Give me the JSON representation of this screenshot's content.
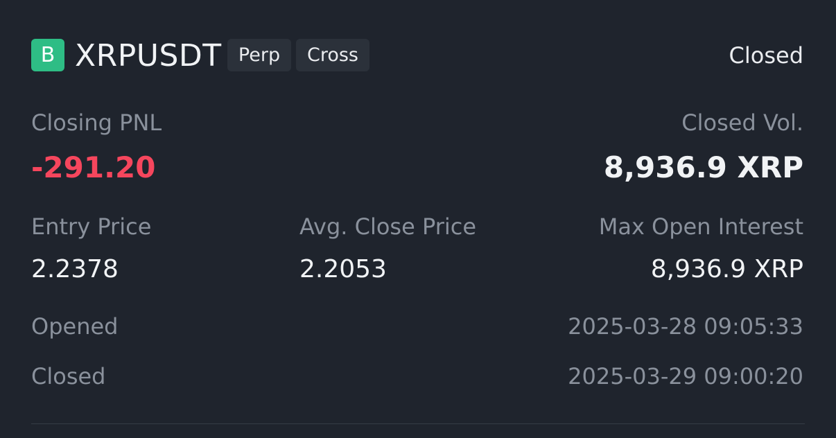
{
  "position": {
    "side_badge": "B",
    "symbol": "XRPUSDT",
    "tags": [
      "Perp",
      "Cross"
    ],
    "status": "Closed"
  },
  "summary": {
    "closing_pnl_label": "Closing PNL",
    "closing_pnl_value": "-291.20",
    "closed_vol_label": "Closed Vol.",
    "closed_vol_value": "8,936.9 XRP"
  },
  "details": {
    "entry_price_label": "Entry Price",
    "entry_price_value": "2.2378",
    "avg_close_price_label": "Avg. Close Price",
    "avg_close_price_value": "2.2053",
    "max_open_interest_label": "Max Open Interest",
    "max_open_interest_value": "8,936.9 XRP"
  },
  "times": {
    "opened_label": "Opened",
    "opened_value": "2025-03-28 09:05:33",
    "closed_label": "Closed",
    "closed_value": "2025-03-29 09:00:20"
  },
  "colors": {
    "background": "#1f242d",
    "buy_badge": "#2ebd85",
    "negative_pnl": "#f6465d",
    "tag_bg": "#2b313a",
    "muted_text": "#8a919c"
  }
}
